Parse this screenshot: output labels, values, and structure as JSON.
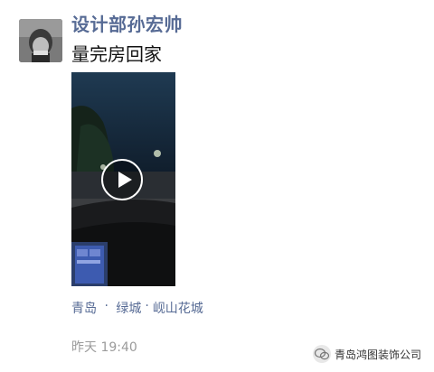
{
  "post": {
    "username": "设计部孙宏帅",
    "text": "量完房回家",
    "location": {
      "parts": [
        "青岛",
        "绿城",
        "岘山花城"
      ]
    },
    "time": "昨天 19:40"
  },
  "video": {
    "icon": "play-icon"
  },
  "watermark": {
    "text": "青岛鸿图装饰公司",
    "icon": "wechat-icon"
  },
  "colors": {
    "link": "#576b95",
    "time": "#9b9b9b",
    "text": "#111111"
  }
}
